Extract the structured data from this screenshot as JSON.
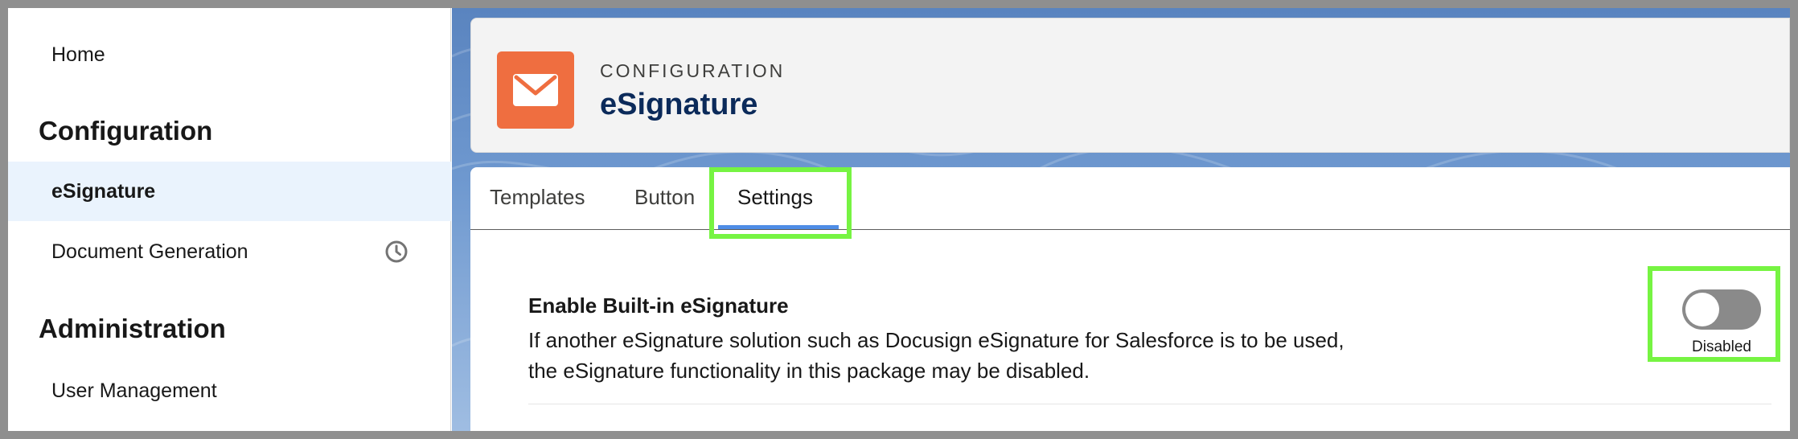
{
  "sidebar": {
    "home_label": "Home",
    "section_configuration": "Configuration",
    "items_configuration": [
      {
        "label": "eSignature",
        "active": true
      },
      {
        "label": "Document Generation",
        "icon": "clock-icon"
      }
    ],
    "section_administration": "Administration",
    "items_administration": [
      {
        "label": "User Management"
      }
    ]
  },
  "header": {
    "eyebrow": "CONFIGURATION",
    "title": "eSignature",
    "icon": "envelope-icon",
    "icon_color": "#ef6e40"
  },
  "tabs": [
    {
      "label": "Templates"
    },
    {
      "label": "Button"
    },
    {
      "label": "Settings",
      "active": true
    }
  ],
  "setting": {
    "title": "Enable Built-in eSignature",
    "description_line1": "If another eSignature solution such as Docusign eSignature for Salesforce is to be used,",
    "description_line2": "the eSignature functionality in this package may be disabled.",
    "toggle_state_label": "Disabled",
    "enabled": false
  },
  "colors": {
    "highlight": "#76f442",
    "tab_active_underline": "#4f8de6",
    "title_navy": "#0b2a5a",
    "active_item_bg": "#eaf3fd"
  }
}
